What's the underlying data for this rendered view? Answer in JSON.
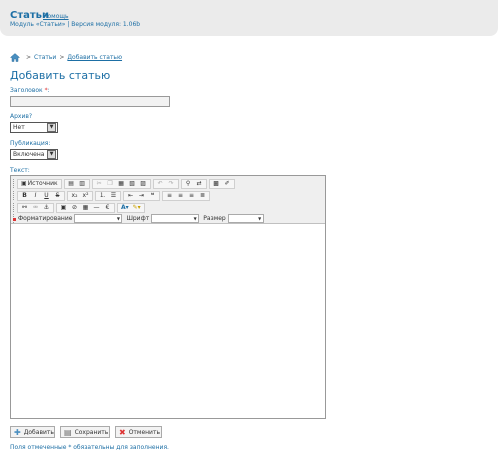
{
  "header": {
    "title": "Статьи",
    "help": "Помощь",
    "module_info": "Модуль «Статьи» | Версия модуля: 1.06b"
  },
  "breadcrumb": {
    "sep": ">",
    "items": [
      "Статьи",
      "Добавить статью"
    ]
  },
  "page_title": "Добавить статью",
  "form": {
    "title_label": "Заголовок",
    "required_mark": "*",
    "title_colon": ":",
    "title_value": "",
    "archive_label": "Архив?",
    "archive_value": "Нет",
    "publish_label": "Публикация:",
    "publish_value": "Включена",
    "text_label": "Текст:"
  },
  "editor": {
    "source_label": "Источник",
    "format_label": "Форматирование",
    "font_label": "Шрифт",
    "size_label": "Размер",
    "format_value": "",
    "font_value": "",
    "size_value": "",
    "content": ""
  },
  "buttons": {
    "add": "Добавить",
    "save": "Сохранить",
    "cancel": "Отменить"
  },
  "footnote": "Поля отмеченные * обязательны для заполнения.",
  "colors": {
    "accent": "#1d6fa5",
    "required": "#dd3333",
    "header_bg": "#ebebeb"
  }
}
